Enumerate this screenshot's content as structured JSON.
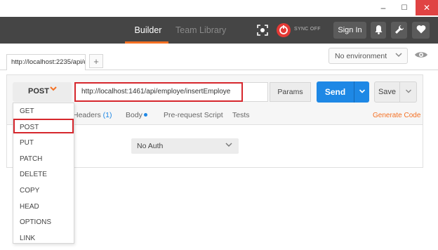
{
  "window": {
    "minimize": "–",
    "maximize": "☐",
    "close": "✕"
  },
  "header": {
    "tabs": {
      "builder": "Builder",
      "team_library": "Team Library"
    },
    "sync_label": "SYNC OFF",
    "sign_in": "Sign In"
  },
  "request_tab": {
    "label": "http://localhost:2235/api/e",
    "add": "+"
  },
  "environment": {
    "selected": "No environment"
  },
  "request": {
    "method": "POST",
    "url": "http://localhost:1461/api/employe/insertEmploye",
    "params_label": "Params",
    "send_label": "Send",
    "save_label": "Save"
  },
  "subtabs": {
    "headers": "Headers",
    "headers_count": "(1)",
    "body": "Body",
    "prerequest": "Pre-request Script",
    "tests": "Tests",
    "generate_code": "Generate Code"
  },
  "auth": {
    "selected": "No Auth"
  },
  "method_menu": {
    "items": [
      "GET",
      "POST",
      "PUT",
      "PATCH",
      "DELETE",
      "COPY",
      "HEAD",
      "OPTIONS",
      "LINK"
    ],
    "highlighted": "POST"
  },
  "colors": {
    "accent": "#f47023",
    "primary": "#1e88e5",
    "header_bg": "#454545",
    "highlight": "#d6272d"
  },
  "icons": [
    "capture-icon",
    "sync-icon",
    "bell-icon",
    "wrench-icon",
    "heart-icon",
    "eye-icon",
    "chevron-down-icon"
  ]
}
